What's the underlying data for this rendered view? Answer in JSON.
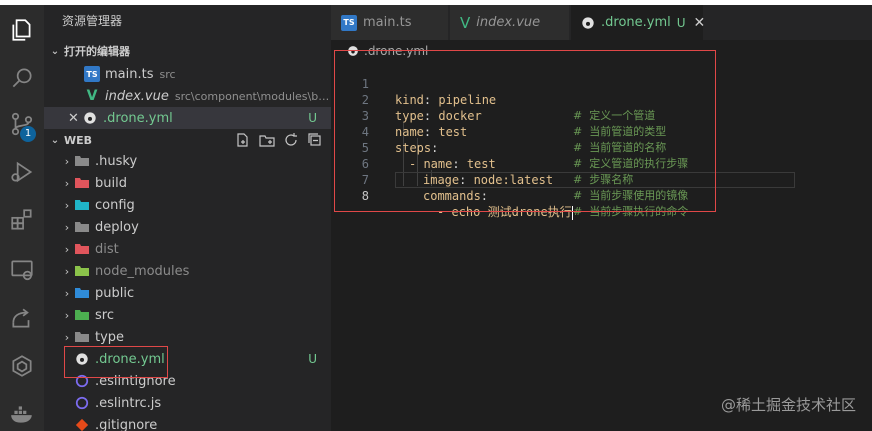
{
  "explorer": {
    "title": "资源管理器",
    "open_editors": {
      "label": "打开的编辑器",
      "items": [
        {
          "name": "main.ts",
          "desc": "src"
        },
        {
          "name": "index.vue",
          "desc": "src\\component\\modules\\base\\..."
        },
        {
          "name": ".drone.yml",
          "status": "U"
        }
      ]
    },
    "workspace": {
      "label": "WEB",
      "folders": [
        ".husky",
        "build",
        "config",
        "deploy",
        "dist",
        "node_modules",
        "public",
        "src",
        "type"
      ],
      "files": [
        {
          "name": ".drone.yml",
          "status": "U"
        },
        {
          "name": ".eslintignore"
        },
        {
          "name": ".eslintrc.js"
        },
        {
          "name": ".gitignore"
        }
      ]
    },
    "activity_badge": "1"
  },
  "tabs": [
    {
      "label": "main.ts"
    },
    {
      "label": "index.vue"
    },
    {
      "label": ".drone.yml",
      "status": "U"
    }
  ],
  "breadcrumb": {
    "file": ".drone.yml"
  },
  "editor": {
    "lines": [
      {
        "n": "1",
        "key": "kind",
        "value": "pipeline",
        "comment": "#  定义一个管道"
      },
      {
        "n": "2",
        "key": "type",
        "value": "docker",
        "comment": "#  当前管道的类型"
      },
      {
        "n": "3",
        "key": "name",
        "value": "test",
        "comment": "#  当前管道的名称"
      },
      {
        "n": "4",
        "key": "steps",
        "value": "",
        "comment": "#  定义管道的执行步骤"
      },
      {
        "n": "5",
        "key": "- name",
        "value": "test",
        "comment": "#  步骤名称"
      },
      {
        "n": "6",
        "key": "image",
        "value": "node:latest",
        "comment": "#  当前步骤使用的镜像"
      },
      {
        "n": "7",
        "key": "commands",
        "value": "",
        "comment": "#  当前步骤执行的命令"
      },
      {
        "n": "8",
        "key": "- echo",
        "value": "测试drone执行",
        "comment": ""
      }
    ]
  },
  "watermark": "@稀土掘金技术社区",
  "colors": {
    "accent": "#0e639c",
    "git_untracked": "#73c991",
    "highlight_box": "#e04848"
  }
}
